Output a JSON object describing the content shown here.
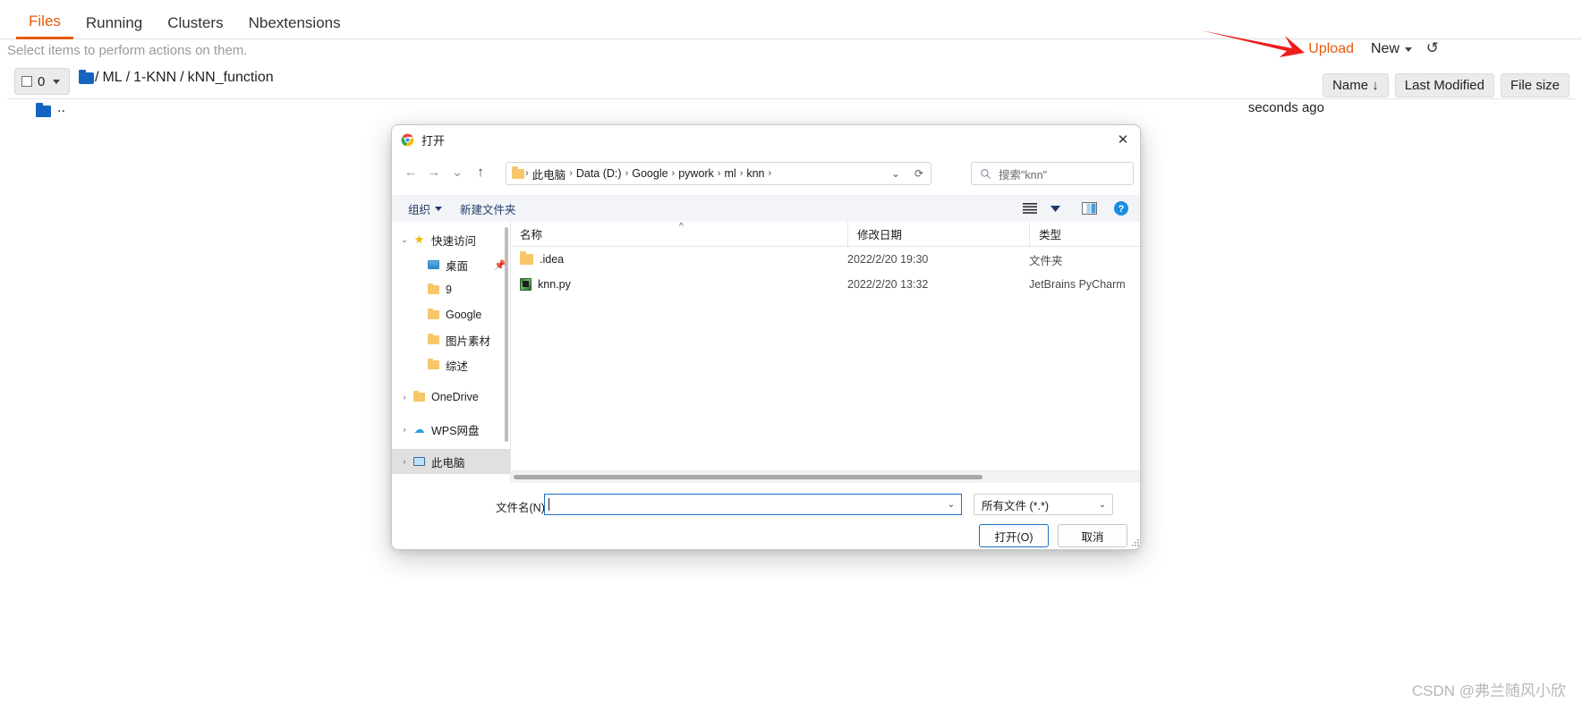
{
  "notebook": {
    "tabs": [
      {
        "label": "Files",
        "active": true
      },
      {
        "label": "Running",
        "active": false
      },
      {
        "label": "Clusters",
        "active": false
      },
      {
        "label": "Nbextensions",
        "active": false
      }
    ],
    "select_hint": "Select items to perform actions on them.",
    "select_count": "0",
    "breadcrumb": [
      "ML",
      "1-KNN",
      "kNN_function"
    ],
    "upload_label": "Upload",
    "new_label": "New",
    "refresh_icon": "refresh-icon",
    "columns": [
      "Name",
      "Last Modified",
      "File size"
    ],
    "sort_arrow": "↓",
    "parent_dir": "..",
    "parent_modified": "seconds ago",
    "watermark": "CSDN @弗兰随风小欣",
    "accent_color": "#e8590c",
    "arrow_color": "#f01c1c"
  },
  "dialog": {
    "title": "打开",
    "app_icon": "chrome-icon",
    "close_label": "✕",
    "nav": {
      "back": "←",
      "forward": "→",
      "recent": "⌄",
      "up": "↑"
    },
    "address": {
      "crumbs": [
        "此电脑",
        "Data (D:)",
        "Google",
        "pywork",
        "ml",
        "knn"
      ],
      "separator": "›",
      "dropdown": "⌄",
      "refresh": "⟳"
    },
    "search": {
      "placeholder": "搜索\"knn\"",
      "icon": "search-icon"
    },
    "commandbar": {
      "organize": "组织",
      "new_folder": "新建文件夹",
      "view_icon": "list-view-icon",
      "view_caret": "▾",
      "preview_icon": "preview-pane-icon",
      "help_icon": "help-icon"
    },
    "sidebar": [
      {
        "label": "快速访问",
        "icon": "star-icon",
        "chevron": "⌄",
        "indent": 0,
        "selected": false
      },
      {
        "label": "桌面",
        "icon": "desktop-icon",
        "chevron": "",
        "indent": 1,
        "selected": false,
        "pinned": true
      },
      {
        "label": "9",
        "icon": "folder-icon",
        "chevron": "",
        "indent": 1,
        "selected": false
      },
      {
        "label": "Google",
        "icon": "folder-icon",
        "chevron": "",
        "indent": 1,
        "selected": false
      },
      {
        "label": "图片素材",
        "icon": "folder-icon",
        "chevron": "",
        "indent": 1,
        "selected": false
      },
      {
        "label": "综述",
        "icon": "folder-icon",
        "chevron": "",
        "indent": 1,
        "selected": false
      },
      {
        "label": "OneDrive",
        "icon": "folder-icon",
        "chevron": "›",
        "indent": 0,
        "selected": false
      },
      {
        "label": "WPS网盘",
        "icon": "cloud-icon",
        "chevron": "›",
        "indent": 0,
        "selected": false
      },
      {
        "label": "此电脑",
        "icon": "pc-icon",
        "chevron": "›",
        "indent": 0,
        "selected": true
      }
    ],
    "list_headers": [
      "名称",
      "修改日期",
      "类型"
    ],
    "files": [
      {
        "name": ".idea",
        "modified": "2022/2/20 19:30",
        "type": "文件夹",
        "icon": "folder-icon"
      },
      {
        "name": "knn.py",
        "modified": "2022/2/20 13:32",
        "type": "JetBrains PyCharm",
        "icon": "python-file-icon"
      }
    ],
    "footer": {
      "filename_label": "文件名(N):",
      "filename_value": "",
      "filter_value": "所有文件 (*.*)",
      "open_button": "打开(O)",
      "cancel_button": "取消"
    }
  }
}
